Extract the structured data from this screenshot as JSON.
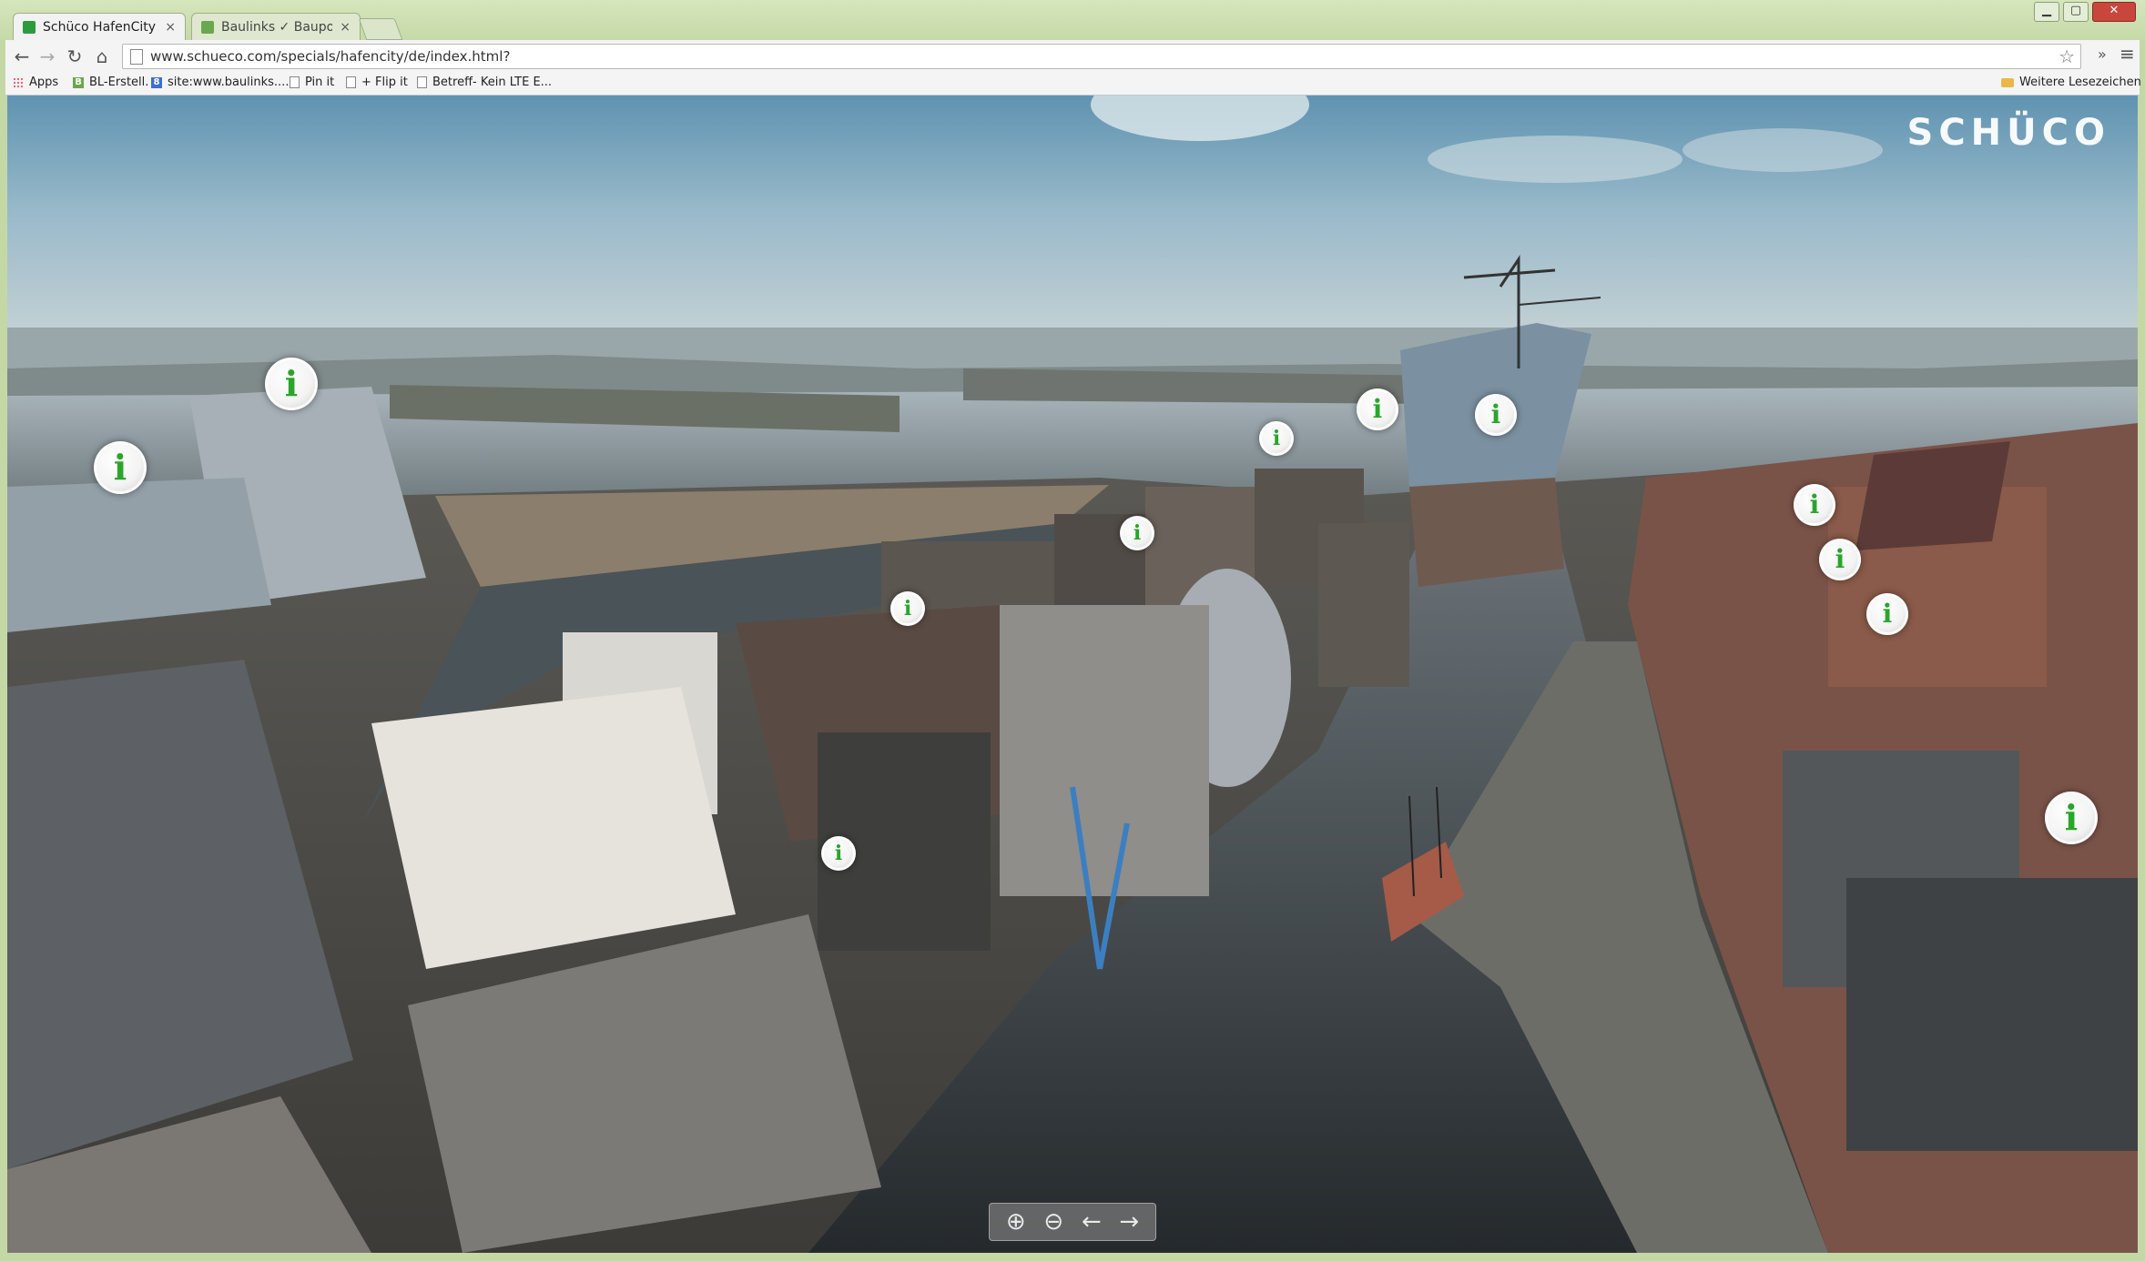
{
  "browser": {
    "tabs": [
      {
        "label": "Schüco HafenCity Hamb",
        "active": true,
        "close": "×"
      },
      {
        "label": "Baulinks ✓ Bauportal fü",
        "active": false,
        "close": "×"
      }
    ],
    "window_buttons": {
      "minimize": "▁",
      "maximize": "▢",
      "close": "✕"
    },
    "url": "www.schueco.com/specials/hafencity/de/index.html?",
    "nav": {
      "back": "←",
      "forward": "→",
      "reload": "↻",
      "home": "⌂",
      "star": "☆",
      "more": "»",
      "menu": "≡"
    },
    "bookmarks": [
      {
        "label": "Apps",
        "icon": "apps-icon"
      },
      {
        "label": "BL-Erstell.",
        "icon": "baulinks-icon"
      },
      {
        "label": "site:www.baulinks....",
        "icon": "google-icon"
      },
      {
        "label": "Pin it",
        "icon": "page-icon"
      },
      {
        "label": "+ Flip it",
        "icon": "page-icon"
      },
      {
        "label": "Betreff- Kein LTE E...",
        "icon": "page-icon"
      }
    ],
    "other_bookmarks": "Weitere Lesezeichen"
  },
  "page": {
    "logo": "SCHÜCO",
    "hotspot_glyph": "i",
    "controls": {
      "zoom_in": "⊕",
      "zoom_out": "⊖",
      "left": "←",
      "right": "→"
    }
  },
  "colors": {
    "hotspot_green": "#2aa62a",
    "frame_green": "#c4d8a6"
  }
}
